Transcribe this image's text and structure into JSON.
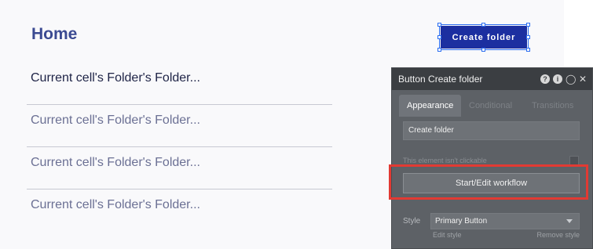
{
  "page": {
    "title": "Home",
    "create_button_label": "Create folder",
    "folder_rows": [
      "Current cell's Folder's Folder...",
      "Current cell's Folder's Folder...",
      "Current cell's Folder's Folder...",
      "Current cell's Folder's Folder..."
    ]
  },
  "panel": {
    "title": "Button Create folder",
    "icons": [
      "help-icon",
      "info-icon",
      "comment-icon",
      "close-icon"
    ],
    "tabs": [
      "Appearance",
      "Conditional",
      "Transitions"
    ],
    "text_value": "Create folder",
    "unclickable_label": "This element isn't clickable",
    "workflow_button": "Start/Edit workflow",
    "style_label": "Style",
    "style_value": "Primary Button",
    "edit_style": "Edit style",
    "remove_style": "Remove style"
  },
  "colors": {
    "accent": "#1c2fa0",
    "title": "#3b4a92",
    "highlight": "#e23a33",
    "panel_bg": "#5d6166"
  }
}
